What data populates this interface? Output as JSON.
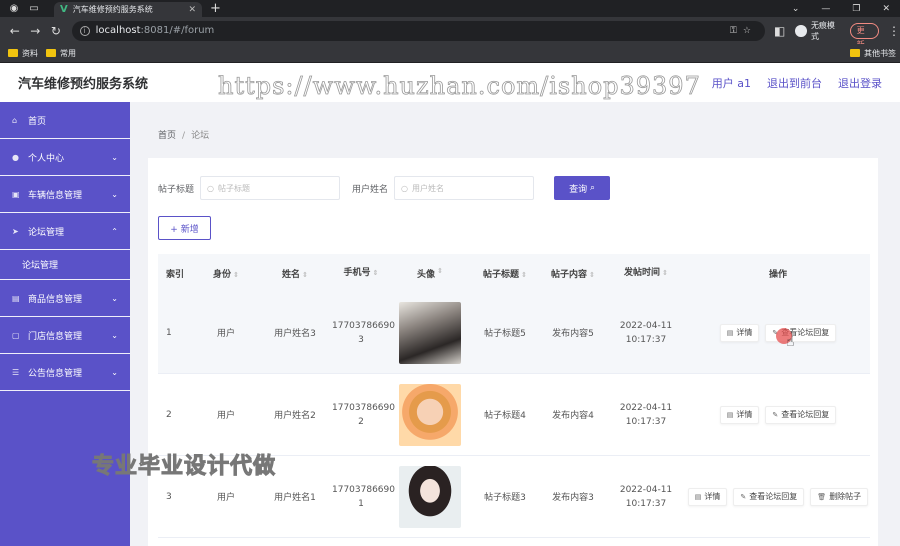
{
  "browser": {
    "tab_title": "汽车维修预约服务系统",
    "url_host": "localhost",
    "url_path": ":8081/#/forum",
    "incognito_label": "无痕模式",
    "update_label": "更新",
    "bookmarks": [
      "资料",
      "常用"
    ],
    "bookmarks_right": "其他书签"
  },
  "header": {
    "title": "汽车维修预约服务系统",
    "links": [
      "用户 a1",
      "退出到前台",
      "退出登录"
    ]
  },
  "sidebar": {
    "items": [
      {
        "label": "首页",
        "icon": "home-icon"
      },
      {
        "label": "个人中心",
        "icon": "user-icon"
      },
      {
        "label": "车辆信息管理",
        "icon": "car-icon"
      },
      {
        "label": "论坛管理",
        "icon": "forum-icon",
        "sub": "论坛管理"
      },
      {
        "label": "商品信息管理",
        "icon": "goods-icon"
      },
      {
        "label": "门店信息管理",
        "icon": "store-icon"
      },
      {
        "label": "公告信息管理",
        "icon": "notice-icon"
      }
    ]
  },
  "breadcrumb": {
    "home": "首页",
    "current": "论坛"
  },
  "search": {
    "label_title": "帖子标题",
    "placeholder_title": "帖子标题",
    "label_user": "用户姓名",
    "placeholder_user": "用户姓名",
    "button": "查询"
  },
  "add_button": "+ 新增",
  "table": {
    "headers": [
      "索引",
      "身份",
      "姓名",
      "手机号",
      "头像",
      "帖子标题",
      "帖子内容",
      "发帖时间",
      "操作"
    ],
    "rows": [
      {
        "index": "1",
        "role": "用户",
        "name": "用户姓名3",
        "phone_a": "17703786690",
        "phone_b": "3",
        "title": "帖子标题5",
        "content": "发布内容5",
        "date": "2022-04-11",
        "time": "10:17:37",
        "ops": [
          "详情",
          "查看论坛回复"
        ]
      },
      {
        "index": "2",
        "role": "用户",
        "name": "用户姓名2",
        "phone_a": "17703786690",
        "phone_b": "2",
        "title": "帖子标题4",
        "content": "发布内容4",
        "date": "2022-04-11",
        "time": "10:17:37",
        "ops": [
          "详情",
          "查看论坛回复"
        ]
      },
      {
        "index": "3",
        "role": "用户",
        "name": "用户姓名1",
        "phone_a": "17703786690",
        "phone_b": "1",
        "title": "帖子标题3",
        "content": "发布内容3",
        "date": "2022-04-11",
        "time": "10:17:37",
        "ops": [
          "详情",
          "查看论坛回复",
          "删除帖子"
        ]
      }
    ]
  },
  "watermarks": {
    "top": "https://www.huzhan.com/ishop39397",
    "bottom": "专业毕业设计代做"
  },
  "colors": {
    "accent": "#5a52c8"
  }
}
